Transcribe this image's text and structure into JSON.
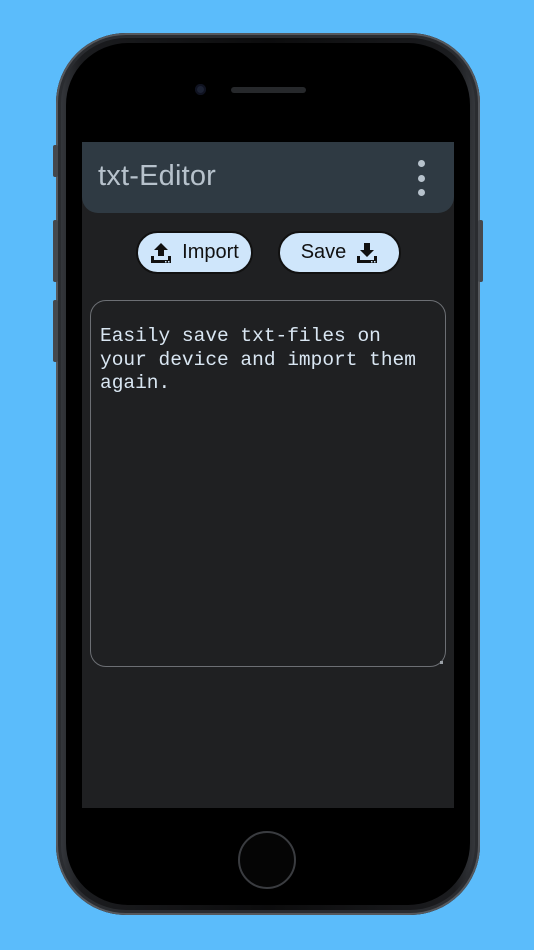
{
  "appbar": {
    "title": "txt-Editor",
    "menu_icon": "more-vert-icon"
  },
  "toolbar": {
    "import_label": "Import",
    "import_icon": "upload-icon",
    "save_label": "Save",
    "save_icon": "download-icon"
  },
  "editor": {
    "value": "Easily save txt-files on\nyour device and import them\nagain."
  },
  "colors": {
    "background": "#5bbcfb",
    "appbar": "#2f3a43",
    "screen": "#1f2022",
    "button": "#cfe6fb",
    "text": "#d9e6f2"
  }
}
